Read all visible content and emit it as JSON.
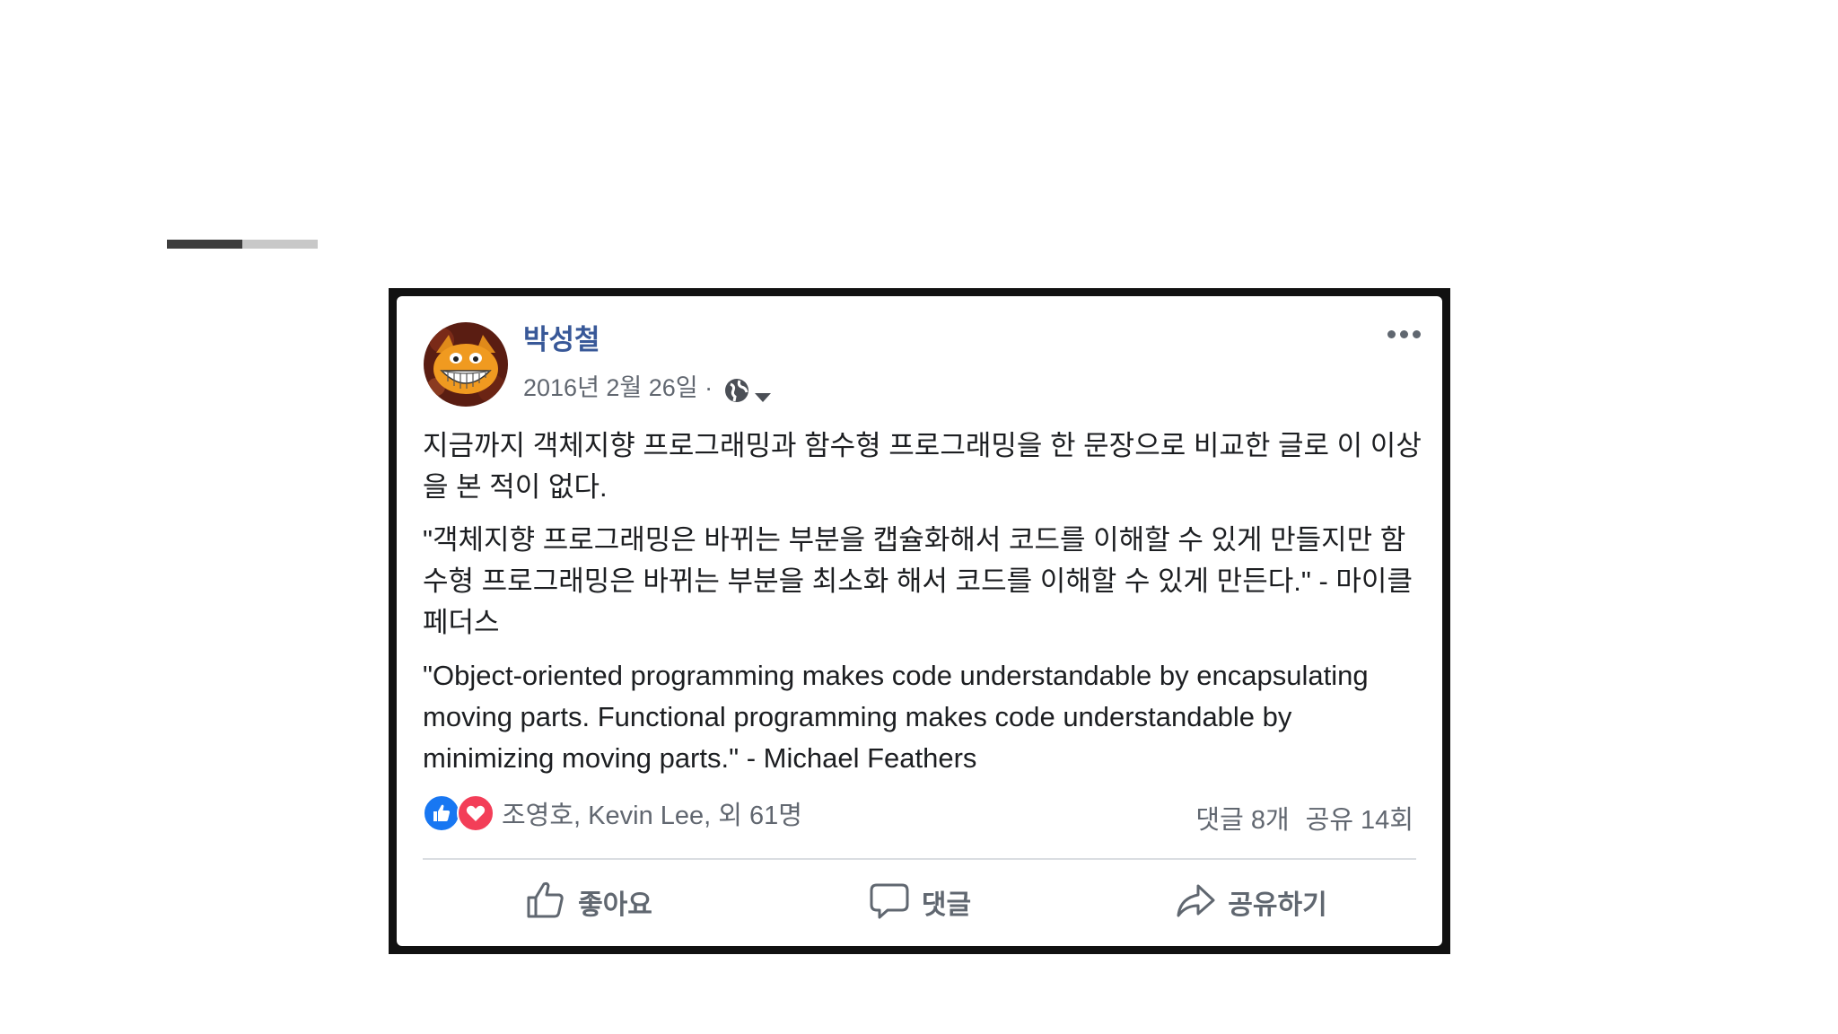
{
  "slide": {
    "progress": 0.5
  },
  "post": {
    "author": "박성철",
    "date": "2016년 2월 26일 ·",
    "paragraphs": [
      "지금까지 객체지향 프로그래밍과 함수형 프로그래밍을 한 문장으로 비교한 글로 이 이상을 본 적이 없다.",
      "\"객체지향 프로그래밍은 바뀌는 부분을 캡슐화해서 코드를 이해할 수 있게 만들지만 함수형 프로그래밍은 바뀌는 부분을 최소화 해서 코드를 이해할 수 있게 만든다.\" - 마이클 페더스",
      "\"Object-oriented programming makes code understandable by encapsulating moving parts. Functional programming makes code understandable by minimizing moving parts.\" - Michael Feathers"
    ],
    "reactions": {
      "icons": [
        "like-icon",
        "love-icon"
      ],
      "names": "조영호, Kevin Lee, 외 61명",
      "comments": "댓글 8개",
      "shares": "공유 14회"
    },
    "actions": {
      "like": "좋아요",
      "comment": "댓글",
      "share": "공유하기"
    }
  },
  "colors": {
    "author": "#385898",
    "like": "#1877f2",
    "love": "#f33e58",
    "text": "#1c1e21",
    "muted": "#616770"
  }
}
